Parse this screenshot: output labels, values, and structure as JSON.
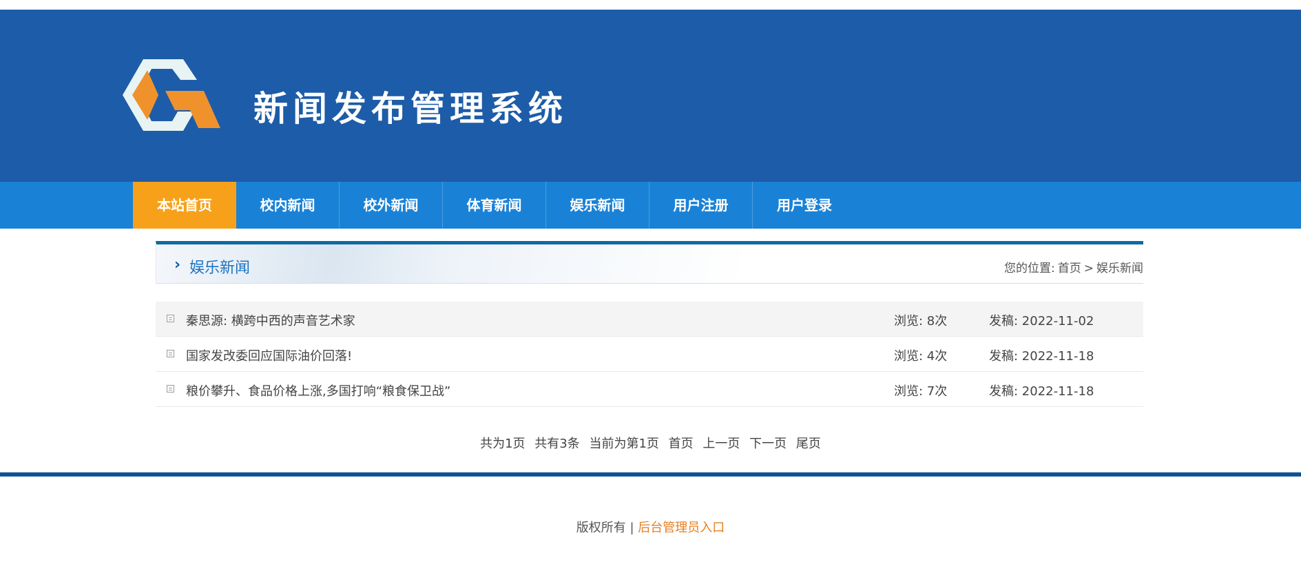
{
  "header": {
    "site_title": "新闻发布管理系统",
    "logo_icon": "logo-icon",
    "colors": {
      "header_bg": "#1d5ca8",
      "logo_hex": "#e8f3f4",
      "logo_accent": "#f0922b"
    }
  },
  "nav": {
    "items": [
      "本站首页",
      "校内新闻",
      "校外新闻",
      "体育新闻",
      "娱乐新闻",
      "用户注册",
      "用户登录"
    ],
    "active_index": 0,
    "colors": {
      "bar": "#1a82d6",
      "active": "#f7a11a"
    }
  },
  "section": {
    "title": "娱乐新闻",
    "breadcrumb_prefix": "您的位置:",
    "breadcrumb_home": "首页",
    "breadcrumb_sep": ">",
    "breadcrumb_current": "娱乐新闻"
  },
  "news": [
    {
      "title": "秦思源: 横跨中西的声音艺术家",
      "views": "浏览: 8次",
      "date": "发稿: 2022-11-02"
    },
    {
      "title": "国家发改委回应国际油价回落!",
      "views": "浏览: 4次",
      "date": "发稿: 2022-11-18"
    },
    {
      "title": "粮价攀升、食品价格上涨,多国打响“粮食保卫战”",
      "views": "浏览: 7次",
      "date": "发稿: 2022-11-18"
    }
  ],
  "pager": {
    "total_pages": "共为1页",
    "total_items": "共有3条",
    "current_page": "当前为第1页",
    "first": "首页",
    "prev": "上一页",
    "next": "下一页",
    "last": "尾页"
  },
  "footer": {
    "copyright": "版权所有",
    "separator": "|",
    "admin_link": "后台管理员入口"
  }
}
